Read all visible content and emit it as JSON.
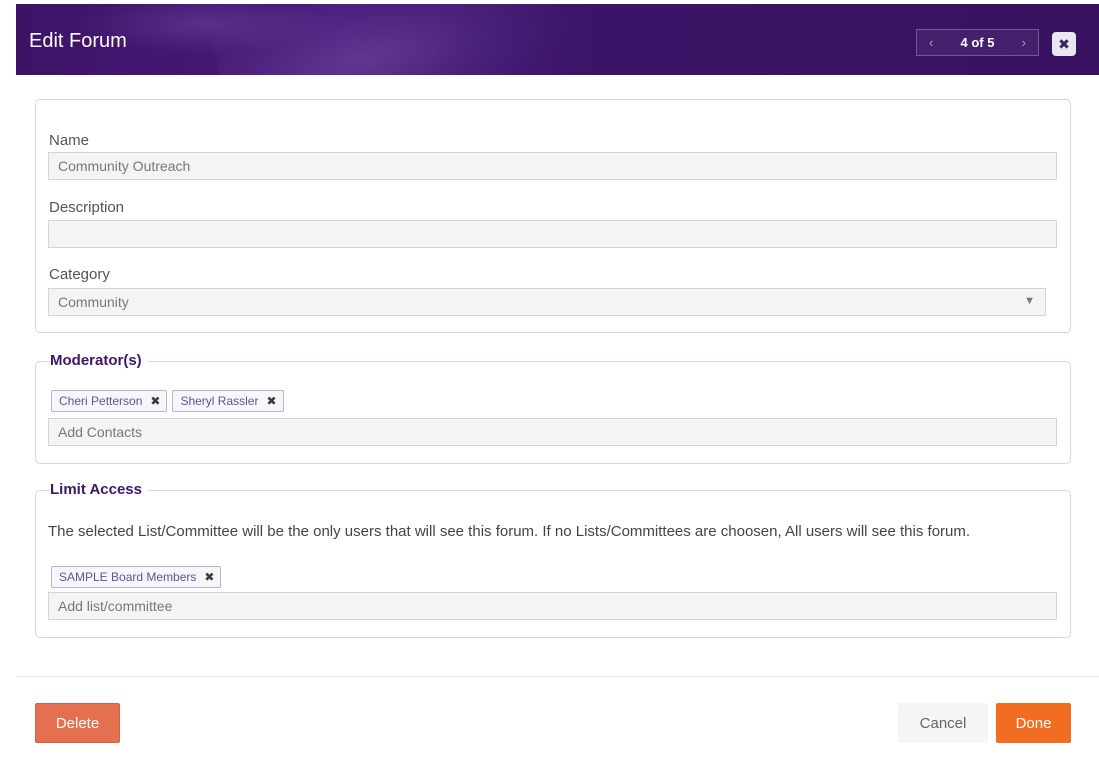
{
  "dialog": {
    "title": "Edit Forum",
    "pager": {
      "prev_icon": "chevron-left-icon",
      "text": "4 of 5",
      "next_icon": "chevron-right-icon"
    },
    "close_icon": "close-icon"
  },
  "details": {
    "name_label": "Name",
    "name_value": "Community Outreach",
    "description_label": "Description",
    "description_value": "",
    "category_label": "Category",
    "category_value": "Community"
  },
  "moderators": {
    "legend": "Moderator(s)",
    "tags": [
      "Cheri Petterson",
      "Sheryl Rassler"
    ],
    "input_placeholder": "Add Contacts"
  },
  "limit_access": {
    "legend": "Limit Access",
    "description": "The selected List/Committee will be the only users that will see this forum. If no Lists/Committees are choosen, All users will see this forum.",
    "tags": [
      "SAMPLE Board Members"
    ],
    "input_placeholder": "Add list/committee"
  },
  "footer": {
    "delete_label": "Delete",
    "cancel_label": "Cancel",
    "done_label": "Done"
  },
  "colors": {
    "header": "#3d1366",
    "accent": "#f26d21",
    "delete": "#e5704f",
    "legend": "#3f1768"
  }
}
